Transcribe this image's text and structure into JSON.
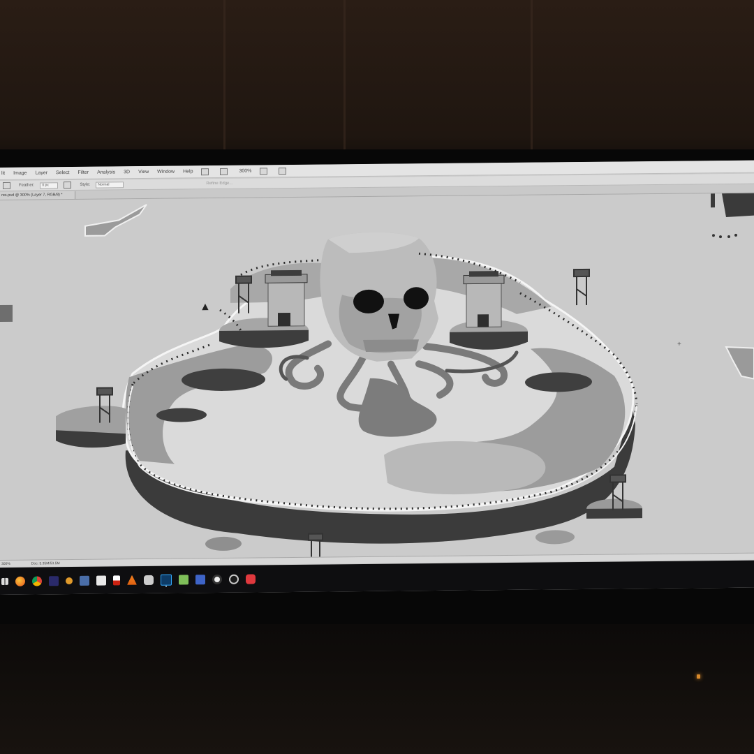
{
  "menubar": {
    "items": [
      "lit",
      "Image",
      "Layer",
      "Select",
      "Filter",
      "Analysis",
      "3D",
      "View",
      "Window",
      "Help"
    ],
    "zoom": "300%"
  },
  "options": {
    "feather_label": "Feather:",
    "feather_value": "0 px",
    "style_label": "Style:",
    "style_value": "Normal",
    "refine_label": "Refine Edge..."
  },
  "document": {
    "tab_title": "res.psd @ 300% (Layer 7, RGB/8) *"
  },
  "status": {
    "zoom": "300%",
    "doc_size": "Doc: 5.35M/53.5M"
  },
  "taskbar": {
    "icons": [
      "start-icon",
      "firefox-icon",
      "chrome-icon",
      "ae-icon",
      "folder-icon",
      "photos-icon",
      "excel-icon",
      "pdf-icon",
      "vlc-icon",
      "chat-icon",
      "photoshop-icon",
      "notepad-icon",
      "vs-icon",
      "obs-icon",
      "steam-icon",
      "app-icon"
    ]
  },
  "colors": {
    "screen_bg": "#c9c9c9",
    "island_light": "#dcdcdc",
    "island_mid": "#9a9a9a",
    "island_dark": "#3f3f3f",
    "taskbar": "#0e0e10"
  }
}
